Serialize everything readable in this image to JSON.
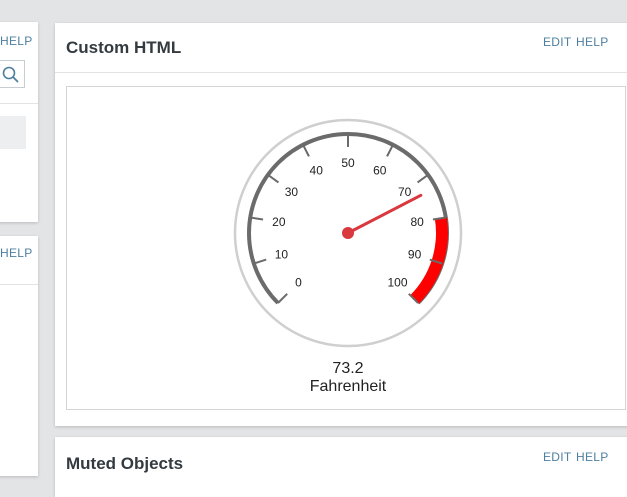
{
  "left_panel": {
    "help_label_top": "HELP",
    "help_label_bottom": "HELP",
    "search_icon": "search-icon"
  },
  "custom_html": {
    "title": "Custom HTML",
    "edit_label": "EDIT",
    "help_label": "HELP",
    "gauge": {
      "value": 73.2,
      "value_label": "73.2",
      "unit": "Fahrenheit",
      "min": 0,
      "max": 100,
      "tick_labels": [
        "0",
        "10",
        "20",
        "30",
        "40",
        "50",
        "60",
        "70",
        "80",
        "90",
        "100"
      ],
      "red_zone": [
        80,
        100
      ],
      "colors": {
        "scale": "#6b6b6b",
        "rim": "#cfcfcf",
        "needle": "#d9383e",
        "red_zone": "#ff0000"
      }
    }
  },
  "muted_objects": {
    "title": "Muted Objects",
    "edit_label": "EDIT",
    "help_label": "HELP"
  }
}
